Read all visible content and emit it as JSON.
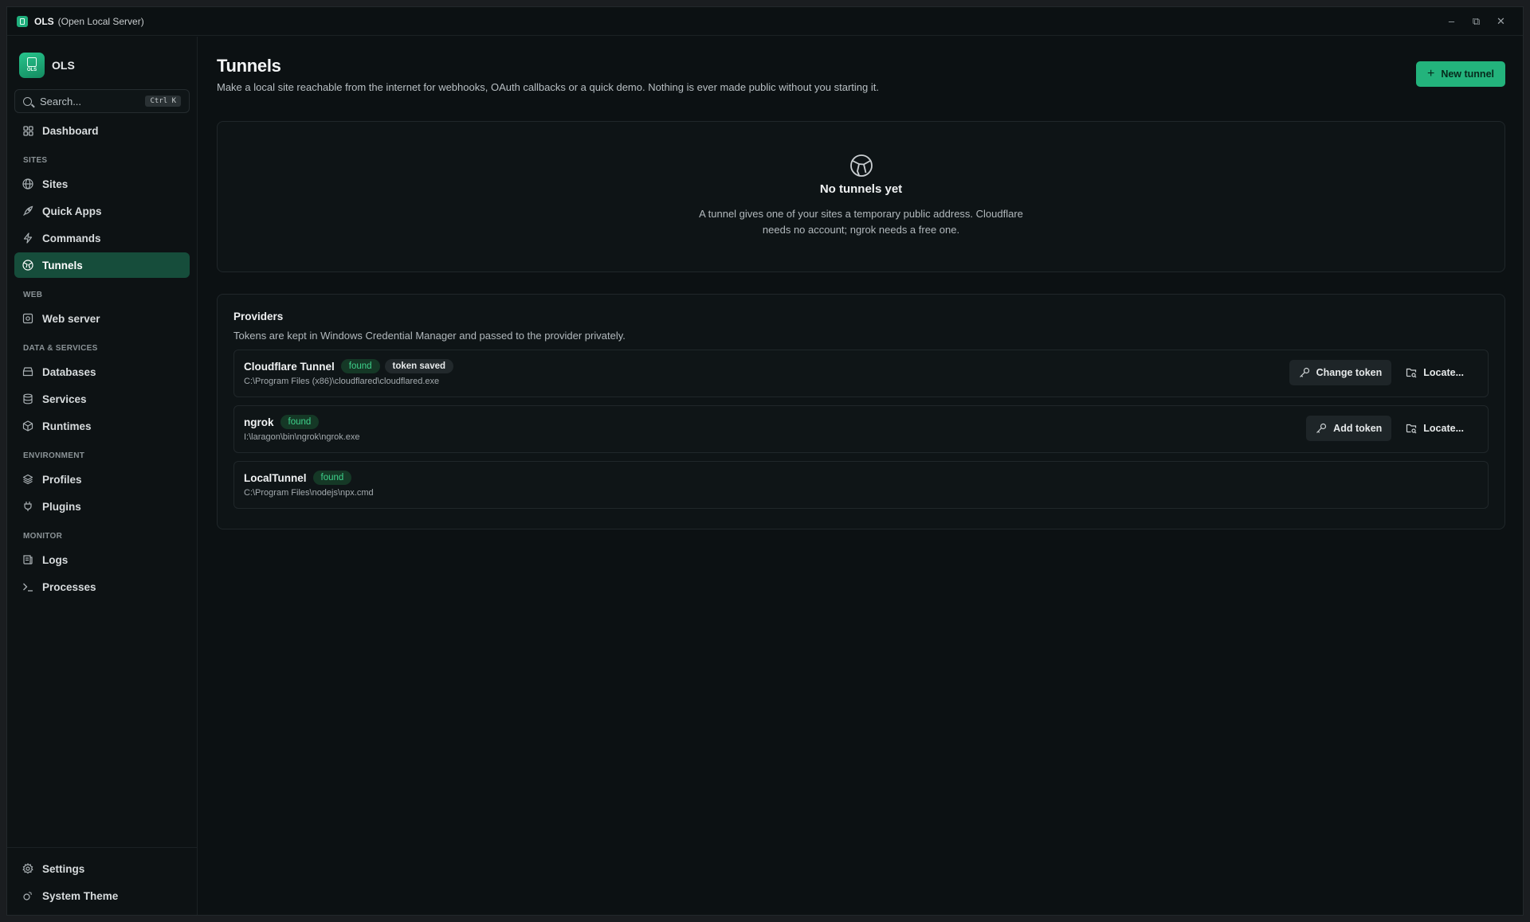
{
  "window": {
    "title": "OLS",
    "subtitle": "(Open Local Server)"
  },
  "brand": {
    "logo_text": "OLS",
    "name": "OLS"
  },
  "search": {
    "placeholder": "Search...",
    "shortcut": "Ctrl K"
  },
  "nav": {
    "dashboard": "Dashboard",
    "sections": {
      "sites": "SITES",
      "web": "WEB",
      "data": "DATA & SERVICES",
      "environment": "ENVIRONMENT",
      "monitor": "MONITOR"
    },
    "items": {
      "sites": "Sites",
      "quick_apps": "Quick Apps",
      "commands": "Commands",
      "tunnels": "Tunnels",
      "web_server": "Web server",
      "databases": "Databases",
      "services": "Services",
      "runtimes": "Runtimes",
      "profiles": "Profiles",
      "plugins": "Plugins",
      "logs": "Logs",
      "processes": "Processes"
    },
    "bottom": {
      "settings": "Settings",
      "theme": "System Theme"
    },
    "active": "tunnels"
  },
  "page": {
    "title": "Tunnels",
    "description": "Make a local site reachable from the internet for webhooks, OAuth callbacks or a quick demo. Nothing is ever made public without you starting it.",
    "new_button": "New tunnel"
  },
  "empty_state": {
    "icon": "globe-icon",
    "title": "No tunnels yet",
    "text": "A tunnel gives one of your sites a temporary public address. Cloudflare needs no account; ngrok needs a free one."
  },
  "providers": {
    "title": "Providers",
    "description": "Tokens are kept in Windows Credential Manager and passed to the provider privately.",
    "items": [
      {
        "name": "Cloudflare Tunnel",
        "status": "found",
        "token": "token saved",
        "path": "C:\\Program Files (x86)\\cloudflared\\cloudflared.exe",
        "token_action": "Change token",
        "locate": "Locate..."
      },
      {
        "name": "ngrok",
        "status": "found",
        "path": "I:\\laragon\\bin\\ngrok\\ngrok.exe",
        "token_action": "Add token",
        "locate": "Locate..."
      },
      {
        "name": "LocalTunnel",
        "status": "found",
        "path": "C:\\Program Files\\nodejs\\npx.cmd"
      }
    ]
  },
  "colors": {
    "accent": "#23b37c",
    "active_nav": "#164d3b",
    "found_text": "#3ed28b",
    "background": "#0c1113"
  }
}
